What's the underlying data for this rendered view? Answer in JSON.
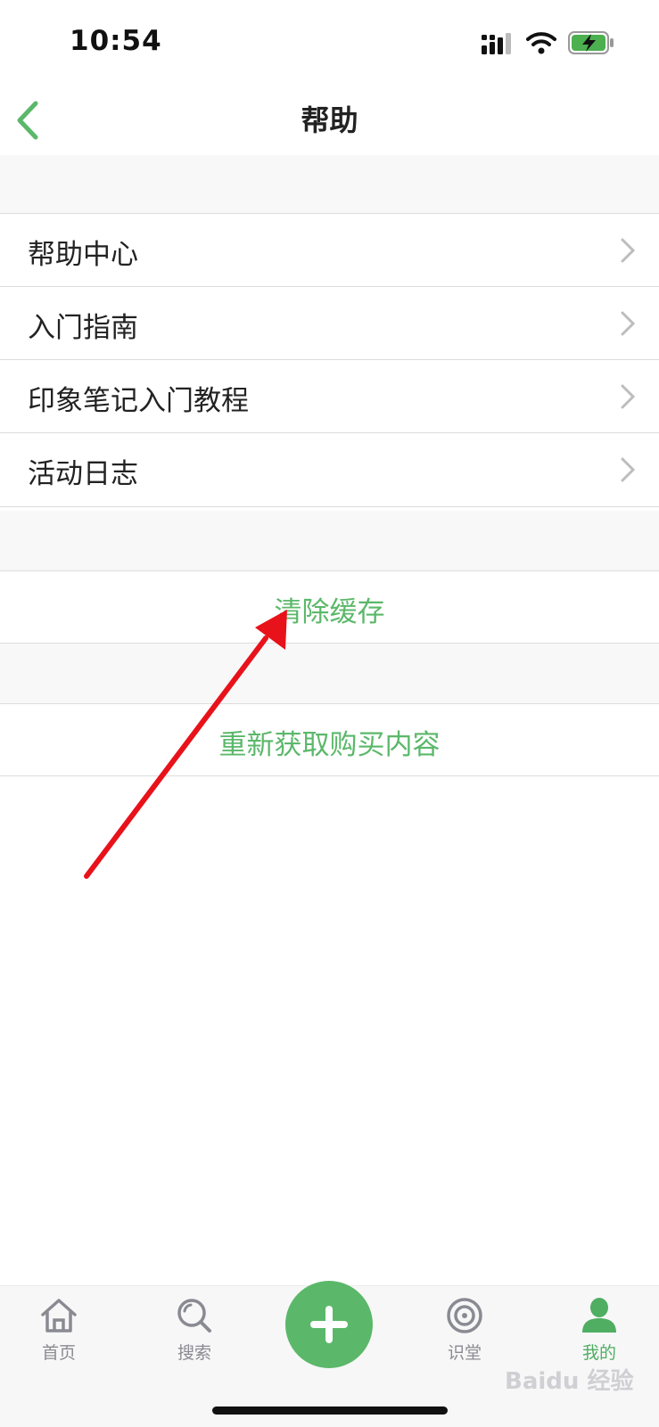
{
  "status_bar": {
    "time": "10:54"
  },
  "header": {
    "title": "帮助"
  },
  "help_items": [
    {
      "label": "帮助中心"
    },
    {
      "label": "入门指南"
    },
    {
      "label": "印象笔记入门教程"
    },
    {
      "label": "活动日志"
    }
  ],
  "actions": {
    "clear_cache": "清除缓存",
    "restore_purchases": "重新获取购买内容"
  },
  "tab_bar": {
    "home": "首页",
    "search": "搜索",
    "learn": "识堂",
    "me": "我的"
  },
  "watermark": "Baidu 经验",
  "colors": {
    "accent": "#5bb86a",
    "annotation_arrow": "#e8121a"
  }
}
